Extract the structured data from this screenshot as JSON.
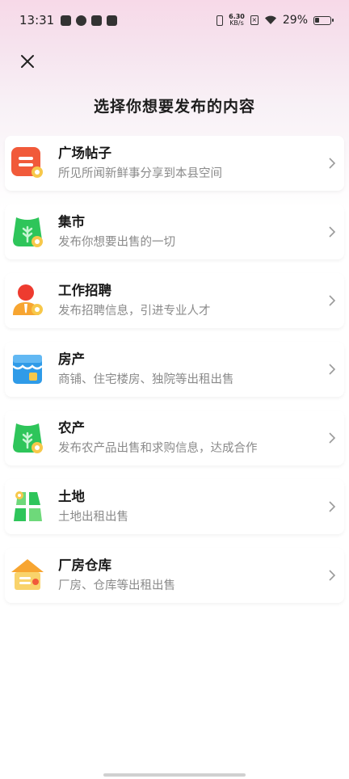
{
  "status_bar": {
    "time": "13:31",
    "net_speed_value": "6.30",
    "net_speed_unit": "KB/s",
    "battery": "29%"
  },
  "header": {
    "title": "选择你想要发布的内容"
  },
  "items": [
    {
      "name": "广场帖子",
      "desc": "所见所闻新鲜事分享到本县空间",
      "icon": "square-post-icon"
    },
    {
      "name": "集市",
      "desc": "发布你想要出售的一切",
      "icon": "market-sack-icon"
    },
    {
      "name": "工作招聘",
      "desc": "发布招聘信息，引进专业人才",
      "icon": "job-person-icon"
    },
    {
      "name": "房产",
      "desc": "商铺、住宅楼房、独院等出租出售",
      "icon": "shop-house-icon"
    },
    {
      "name": "农产",
      "desc": "发布农产品出售和求购信息，达成合作",
      "icon": "farm-sack-icon"
    },
    {
      "name": "土地",
      "desc": "土地出租出售",
      "icon": "land-fields-icon"
    },
    {
      "name": "厂房仓库",
      "desc": "厂房、仓库等出租出售",
      "icon": "warehouse-icon"
    }
  ],
  "colors": {
    "red": "#f15a3a",
    "green": "#2ec55a",
    "blue": "#2f9be8",
    "orange": "#f7a531"
  }
}
